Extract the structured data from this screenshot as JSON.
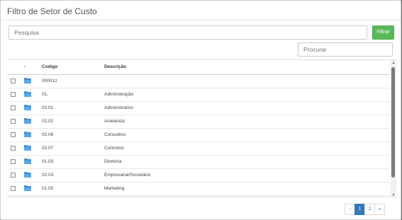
{
  "dialog": {
    "title": "Filtro de Setor de Custo"
  },
  "search": {
    "placeholder": "Pesquisa",
    "button_label": "Filtrar"
  },
  "table_search": {
    "placeholder": "Procurar"
  },
  "table": {
    "columns": {
      "sort": "-",
      "code": "Codigo",
      "description": "Descrição"
    },
    "rows": [
      {
        "code": "000012",
        "description": ""
      },
      {
        "code": "01.",
        "description": "Administração"
      },
      {
        "code": "02.01",
        "description": "Administrativo"
      },
      {
        "code": "02.02",
        "description": "Ambiental"
      },
      {
        "code": "02.06",
        "description": "Consultivo"
      },
      {
        "code": "02.07",
        "description": "Contratos"
      },
      {
        "code": "01.03",
        "description": "Diretoria"
      },
      {
        "code": "02.03",
        "description": "Empresarial/Societário"
      },
      {
        "code": "01.02",
        "description": "Marketing"
      }
    ]
  },
  "pagination": {
    "prev": "«",
    "pages": [
      "1",
      "2"
    ],
    "next": "»",
    "current": "1"
  },
  "colors": {
    "accent": "#337ab7",
    "filter_button": "#5cb85c",
    "folder": "#3a8fd6"
  },
  "icons": {
    "row_icon": "folder-icon"
  }
}
